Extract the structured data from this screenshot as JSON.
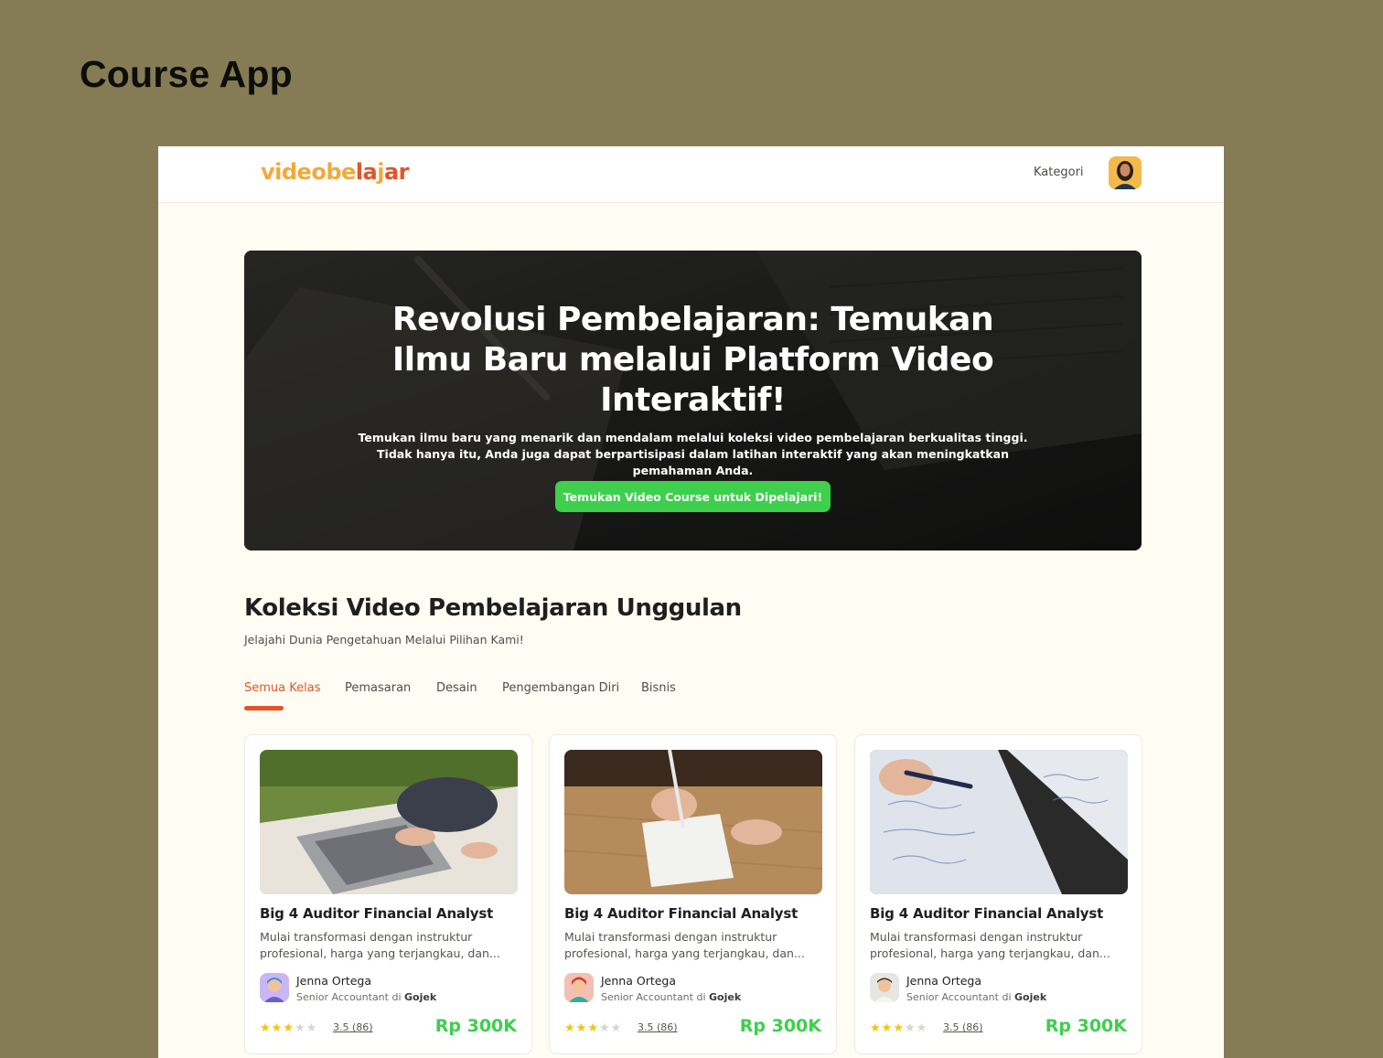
{
  "page_label": "Course App",
  "colors": {
    "background": "#857c55",
    "frame": "#fffdf3",
    "logo_primary": "#f2a93b",
    "logo_accent": "#e0552a",
    "cta_green": "#3ecf4c",
    "active_tab": "#e0552a",
    "star": "#f4c20d"
  },
  "navbar": {
    "logo_part1": "videobe",
    "logo_part2": "la",
    "logo_part3": "j",
    "logo_part4": "ar",
    "menu_kategori": "Kategori",
    "avatar_icon": "user-avatar"
  },
  "hero": {
    "title": "Revolusi Pembelajaran: Temukan Ilmu Baru melalui Platform Video Interaktif!",
    "subtitle": "Temukan ilmu baru yang menarik dan mendalam melalui koleksi video pembelajaran berkualitas tinggi. Tidak hanya itu, Anda juga dapat berpartisipasi dalam latihan interaktif yang akan meningkatkan pemahaman Anda.",
    "cta_label": "Temukan Video Course untuk Dipelajari!"
  },
  "section": {
    "title": "Koleksi Video Pembelajaran Unggulan",
    "subtitle": "Jelajahi Dunia Pengetahuan Melalui Pilihan Kami!"
  },
  "tabs": [
    {
      "label": "Semua Kelas",
      "active": true
    },
    {
      "label": "Pemasaran",
      "active": false
    },
    {
      "label": "Desain",
      "active": false
    },
    {
      "label": "Pengembangan Diri",
      "active": false
    },
    {
      "label": "Bisnis",
      "active": false
    }
  ],
  "courses": [
    {
      "title": "Big 4 Auditor Financial Analyst",
      "description": "Mulai transformasi dengan instruktur profesional, harga yang terjangkau, dan...",
      "instructor_name": "Jenna Ortega",
      "instructor_role": "Senior Accountant di",
      "instructor_company": "Gojek",
      "rating_value": 3.5,
      "rating_text": "3.5 (86)",
      "price": "Rp 300K",
      "thumbnail": "laptop-on-blanket-image"
    },
    {
      "title": "Big 4 Auditor Financial Analyst",
      "description": "Mulai transformasi dengan instruktur profesional, harga yang terjangkau, dan...",
      "instructor_name": "Jenna Ortega",
      "instructor_role": "Senior Accountant di",
      "instructor_company": "Gojek",
      "rating_value": 3.5,
      "rating_text": "3.5 (86)",
      "price": "Rp 300K",
      "thumbnail": "writing-notebook-image"
    },
    {
      "title": "Big 4 Auditor Financial Analyst",
      "description": "Mulai transformasi dengan instruktur profesional, harga yang terjangkau, dan...",
      "instructor_name": "Jenna Ortega",
      "instructor_role": "Senior Accountant di",
      "instructor_company": "Gojek",
      "rating_value": 3.5,
      "rating_text": "3.5 (86)",
      "price": "Rp 300K",
      "thumbnail": "math-notes-image"
    }
  ]
}
